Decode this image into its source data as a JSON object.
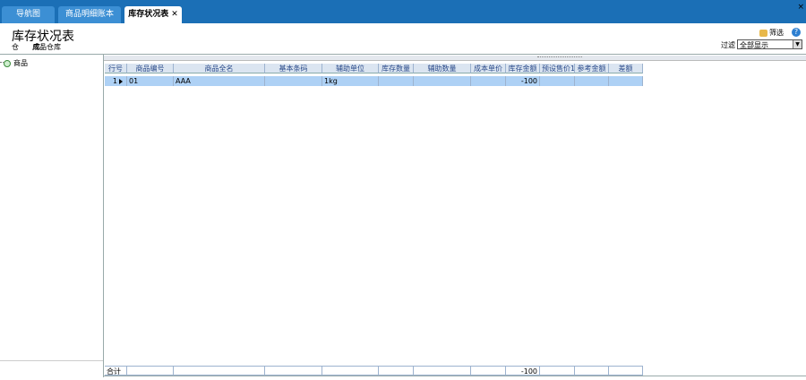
{
  "tabs": [
    {
      "label": "导航图"
    },
    {
      "label": "商品明细账本"
    },
    {
      "label": "库存状况表",
      "close": "✕"
    }
  ],
  "window_close": "×",
  "page": {
    "title": "库存状况表",
    "warehouse_label": "仓　　库：",
    "warehouse_value": "成品仓库"
  },
  "toolbar": {
    "filter_button": "筛选",
    "help_icon": "?",
    "filter_label": "过滤",
    "filter_selected": "全部显示"
  },
  "tree": {
    "root_label": "商品"
  },
  "table": {
    "columns": [
      "行号",
      "商品编号",
      "商品全名",
      "基本条码",
      "辅助单位",
      "库存数量",
      "辅助数量",
      "成本单价",
      "库存金额",
      "预设售价1",
      "参考金额",
      "差额"
    ],
    "rows": [
      [
        "1",
        "01",
        "AAA",
        "",
        "1kg",
        "",
        "",
        "",
        "-100",
        "",
        "",
        ""
      ]
    ],
    "footer": [
      "合计",
      "",
      "",
      "",
      "",
      "",
      "",
      "",
      "-100",
      "",
      "",
      ""
    ]
  }
}
